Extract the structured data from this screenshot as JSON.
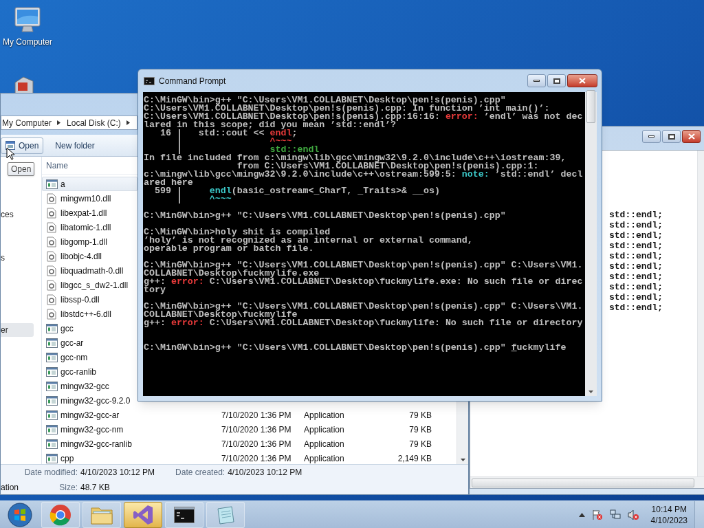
{
  "desktop_icons": [
    {
      "label": "My Computer"
    }
  ],
  "explorer": {
    "breadcrumb": [
      "My Computer",
      "Local Disk (C:)"
    ],
    "toolbar": [
      {
        "label": "Open",
        "kind": "with_icon",
        "hover": true
      },
      {
        "label": "New folder",
        "kind": "text_only",
        "hover": false
      }
    ],
    "tooltip": "Open",
    "nav_items": [
      {
        "label": "ces",
        "selected": false
      },
      {
        "label": "s",
        "selected": false
      },
      {
        "label": "er",
        "selected": true
      }
    ],
    "column_header": "Name",
    "files": [
      {
        "name": "a",
        "kind": "app",
        "selected": true
      },
      {
        "name": "mingwm10.dll",
        "kind": "dll",
        "selected": false
      },
      {
        "name": "libexpat-1.dll",
        "kind": "dll",
        "selected": false
      },
      {
        "name": "libatomic-1.dll",
        "kind": "dll",
        "selected": false
      },
      {
        "name": "libgomp-1.dll",
        "kind": "dll",
        "selected": false
      },
      {
        "name": "libobjc-4.dll",
        "kind": "dll",
        "selected": false
      },
      {
        "name": "libquadmath-0.dll",
        "kind": "dll",
        "selected": false
      },
      {
        "name": "libgcc_s_dw2-1.dll",
        "kind": "dll",
        "selected": false
      },
      {
        "name": "libssp-0.dll",
        "kind": "dll",
        "selected": false
      },
      {
        "name": "libstdc++-6.dll",
        "kind": "dll",
        "selected": false
      },
      {
        "name": "gcc",
        "kind": "app",
        "selected": false
      },
      {
        "name": "gcc-ar",
        "kind": "app",
        "selected": false
      },
      {
        "name": "gcc-nm",
        "kind": "app",
        "selected": false
      },
      {
        "name": "gcc-ranlib",
        "kind": "app",
        "selected": false
      },
      {
        "name": "mingw32-gcc",
        "kind": "app",
        "selected": false
      },
      {
        "name": "mingw32-gcc-9.2.0",
        "kind": "app",
        "selected": false
      },
      {
        "name": "mingw32-gcc-ar",
        "kind": "app",
        "selected": false,
        "date": "7/10/2020 1:36 PM",
        "type": "Application",
        "size": "79 KB"
      },
      {
        "name": "mingw32-gcc-nm",
        "kind": "app",
        "selected": false,
        "date": "7/10/2020 1:36 PM",
        "type": "Application",
        "size": "79 KB"
      },
      {
        "name": "mingw32-gcc-ranlib",
        "kind": "app",
        "selected": false,
        "date": "7/10/2020 1:36 PM",
        "type": "Application",
        "size": "79 KB"
      },
      {
        "name": "cpp",
        "kind": "app",
        "selected": false,
        "date": "7/10/2020 1:36 PM",
        "type": "Application",
        "size": "2,149 KB"
      }
    ],
    "details": {
      "date_modified_label": "Date modified:",
      "date_modified": "4/10/2023 10:12 PM",
      "date_created_label": "Date created:",
      "date_created": "4/10/2023 10:12 PM",
      "type": "ation",
      "size_label": "Size:",
      "size": "48.7 KB"
    }
  },
  "cmd": {
    "title": "Command Prompt",
    "lines": [
      {
        "kind": "text",
        "segments": [
          {
            "text": "C:\\MinGW\\bin>g++ \"C:\\Users\\VM1.COLLABNET\\Desktop\\pen!s(penis).cpp\"",
            "kind": "plain"
          }
        ]
      },
      {
        "kind": "text",
        "segments": [
          {
            "text": "C:\\Users\\VM1.COLLABNET\\Desktop\\pen!s(penis).cpp: In function ’int main()’:",
            "kind": "plain"
          }
        ]
      },
      {
        "kind": "text",
        "segments": [
          {
            "text": "C:\\Users\\VM1.COLLABNET\\Desktop\\pen!s(penis).cpp:16:16: ",
            "kind": "plain"
          },
          {
            "text": "error:",
            "kind": "error"
          },
          {
            "text": " ’endl’ was not dec",
            "kind": "plain"
          }
        ]
      },
      {
        "kind": "text",
        "segments": [
          {
            "text": "lared in this scope; did you mean ’std::endl’?",
            "kind": "plain"
          }
        ]
      },
      {
        "kind": "text",
        "segments": [
          {
            "text": "   16 |   std::cout << ",
            "kind": "plain"
          },
          {
            "text": "endl",
            "kind": "error"
          },
          {
            "text": ";",
            "kind": "plain"
          }
        ]
      },
      {
        "kind": "text",
        "segments": [
          {
            "text": "      |                ",
            "kind": "plain"
          },
          {
            "text": "^~~~",
            "kind": "error"
          }
        ]
      },
      {
        "kind": "text",
        "segments": [
          {
            "text": "      |                ",
            "kind": "plain"
          },
          {
            "text": "std::endl",
            "kind": "fix"
          }
        ]
      },
      {
        "kind": "text",
        "segments": [
          {
            "text": "In file included from c:\\mingw\\lib\\gcc\\mingw32\\9.2.0\\include\\c++\\iostream:39,",
            "kind": "plain"
          }
        ]
      },
      {
        "kind": "text",
        "segments": [
          {
            "text": "                 from C:\\Users\\VM1.COLLABNET\\Desktop\\pen!s(penis).cpp:1:",
            "kind": "plain"
          }
        ]
      },
      {
        "kind": "text",
        "segments": [
          {
            "text": "c:\\mingw\\lib\\gcc\\mingw32\\9.2.0\\include\\c++\\ostream:599:5: ",
            "kind": "plain"
          },
          {
            "text": "note:",
            "kind": "note"
          },
          {
            "text": " ’std::endl’ decl",
            "kind": "plain"
          }
        ]
      },
      {
        "kind": "text",
        "segments": [
          {
            "text": "ared here",
            "kind": "plain"
          }
        ]
      },
      {
        "kind": "text",
        "segments": [
          {
            "text": "  599 |     ",
            "kind": "plain"
          },
          {
            "text": "endl",
            "kind": "note"
          },
          {
            "text": "(basic_ostream<_CharT, _Traits>& __os)",
            "kind": "plain"
          }
        ]
      },
      {
        "kind": "text",
        "segments": [
          {
            "text": "      |     ",
            "kind": "plain"
          },
          {
            "text": "^~~~",
            "kind": "note"
          }
        ]
      },
      {
        "kind": "blank"
      },
      {
        "kind": "text",
        "segments": [
          {
            "text": "C:\\MinGW\\bin>g++ \"C:\\Users\\VM1.COLLABNET\\Desktop\\pen!s(penis).cpp\"",
            "kind": "plain"
          }
        ]
      },
      {
        "kind": "blank"
      },
      {
        "kind": "text",
        "segments": [
          {
            "text": "C:\\MinGW\\bin>holy shit is compiled",
            "kind": "plain"
          }
        ]
      },
      {
        "kind": "text",
        "segments": [
          {
            "text": "’holy’ is not recognized as an internal or external command,",
            "kind": "plain"
          }
        ]
      },
      {
        "kind": "text",
        "segments": [
          {
            "text": "operable program or batch file.",
            "kind": "plain"
          }
        ]
      },
      {
        "kind": "blank"
      },
      {
        "kind": "text",
        "segments": [
          {
            "text": "C:\\MinGW\\bin>g++ \"C:\\Users\\VM1.COLLABNET\\Desktop\\pen!s(penis).cpp\" C:\\Users\\VM1.",
            "kind": "plain"
          }
        ]
      },
      {
        "kind": "text",
        "segments": [
          {
            "text": "COLLABNET\\Desktop\\fuckmylife.exe",
            "kind": "plain"
          }
        ]
      },
      {
        "kind": "text",
        "segments": [
          {
            "text": "g++: ",
            "kind": "plain"
          },
          {
            "text": "error:",
            "kind": "error"
          },
          {
            "text": " C:\\Users\\VM1.COLLABNET\\Desktop\\fuckmylife.exe: No such file or direc",
            "kind": "plain"
          }
        ]
      },
      {
        "kind": "text",
        "segments": [
          {
            "text": "tory",
            "kind": "plain"
          }
        ]
      },
      {
        "kind": "blank"
      },
      {
        "kind": "text",
        "segments": [
          {
            "text": "C:\\MinGW\\bin>g++ \"C:\\Users\\VM1.COLLABNET\\Desktop\\pen!s(penis).cpp\" C:\\Users\\VM1.",
            "kind": "plain"
          }
        ]
      },
      {
        "kind": "text",
        "segments": [
          {
            "text": "COLLABNET\\Desktop\\fuckmylife",
            "kind": "plain"
          }
        ]
      },
      {
        "kind": "text",
        "segments": [
          {
            "text": "g++: ",
            "kind": "plain"
          },
          {
            "text": "error:",
            "kind": "error"
          },
          {
            "text": " C:\\Users\\VM1.COLLABNET\\Desktop\\fuckmylife: No such file or directory",
            "kind": "plain"
          }
        ]
      },
      {
        "kind": "blank"
      },
      {
        "kind": "blank"
      },
      {
        "kind": "text",
        "segments": [
          {
            "text": "C:\\MinGW\\bin>g++ \"C:\\Users\\VM1.COLLABNET\\Desktop\\pen!s(penis).cpp\" ",
            "kind": "plain"
          },
          {
            "text": "f",
            "kind": "cursor"
          },
          {
            "text": "uckmylife",
            "kind": "plain"
          }
        ]
      }
    ]
  },
  "editor": {
    "lines": [
      "std::endl;",
      "std::endl;",
      "std::endl;",
      "std::endl;",
      "std::endl;",
      "std::endl;",
      "std::endl;",
      "std::endl;",
      "std::endl;",
      "std::endl;"
    ]
  },
  "taskbar": {
    "apps": [
      {
        "kind": "browser",
        "active": false
      },
      {
        "kind": "folder",
        "active": false
      },
      {
        "kind": "studio",
        "active": true
      },
      {
        "kind": "console",
        "active": false
      },
      {
        "kind": "notepad",
        "active": false
      }
    ],
    "clock": {
      "time": "10:14 PM",
      "date": "4/10/2023"
    }
  }
}
